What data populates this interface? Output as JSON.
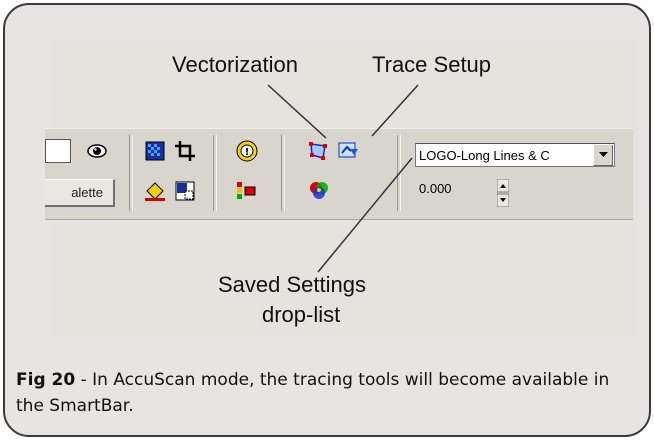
{
  "labels": {
    "vectorization": "Vectorization",
    "trace_setup": "Trace Setup",
    "saved_settings_line1": "Saved Settings",
    "saved_settings_line2": "drop-list"
  },
  "toolbar": {
    "palette_label": "alette",
    "saved_settings_value": "LOGO-Long Lines & C",
    "numeric_value": "0.000",
    "icons": [
      "eye-icon",
      "bitmap-icon",
      "crop-icon",
      "accuscan-icon",
      "vectorization-icon",
      "trace-setup-icon",
      "fill-icon",
      "color-select-icon",
      "color-reduce-icon",
      "color-wheel-icon"
    ]
  },
  "caption": {
    "fig": "Fig 20",
    "text": " - In AccuScan mode, the tracing tools will become available in the SmartBar."
  },
  "colors": {
    "frame_border": "#3a3a3a",
    "panel_bg": "#e6e5e3",
    "toolbar_bg": "#d8d6cc"
  }
}
